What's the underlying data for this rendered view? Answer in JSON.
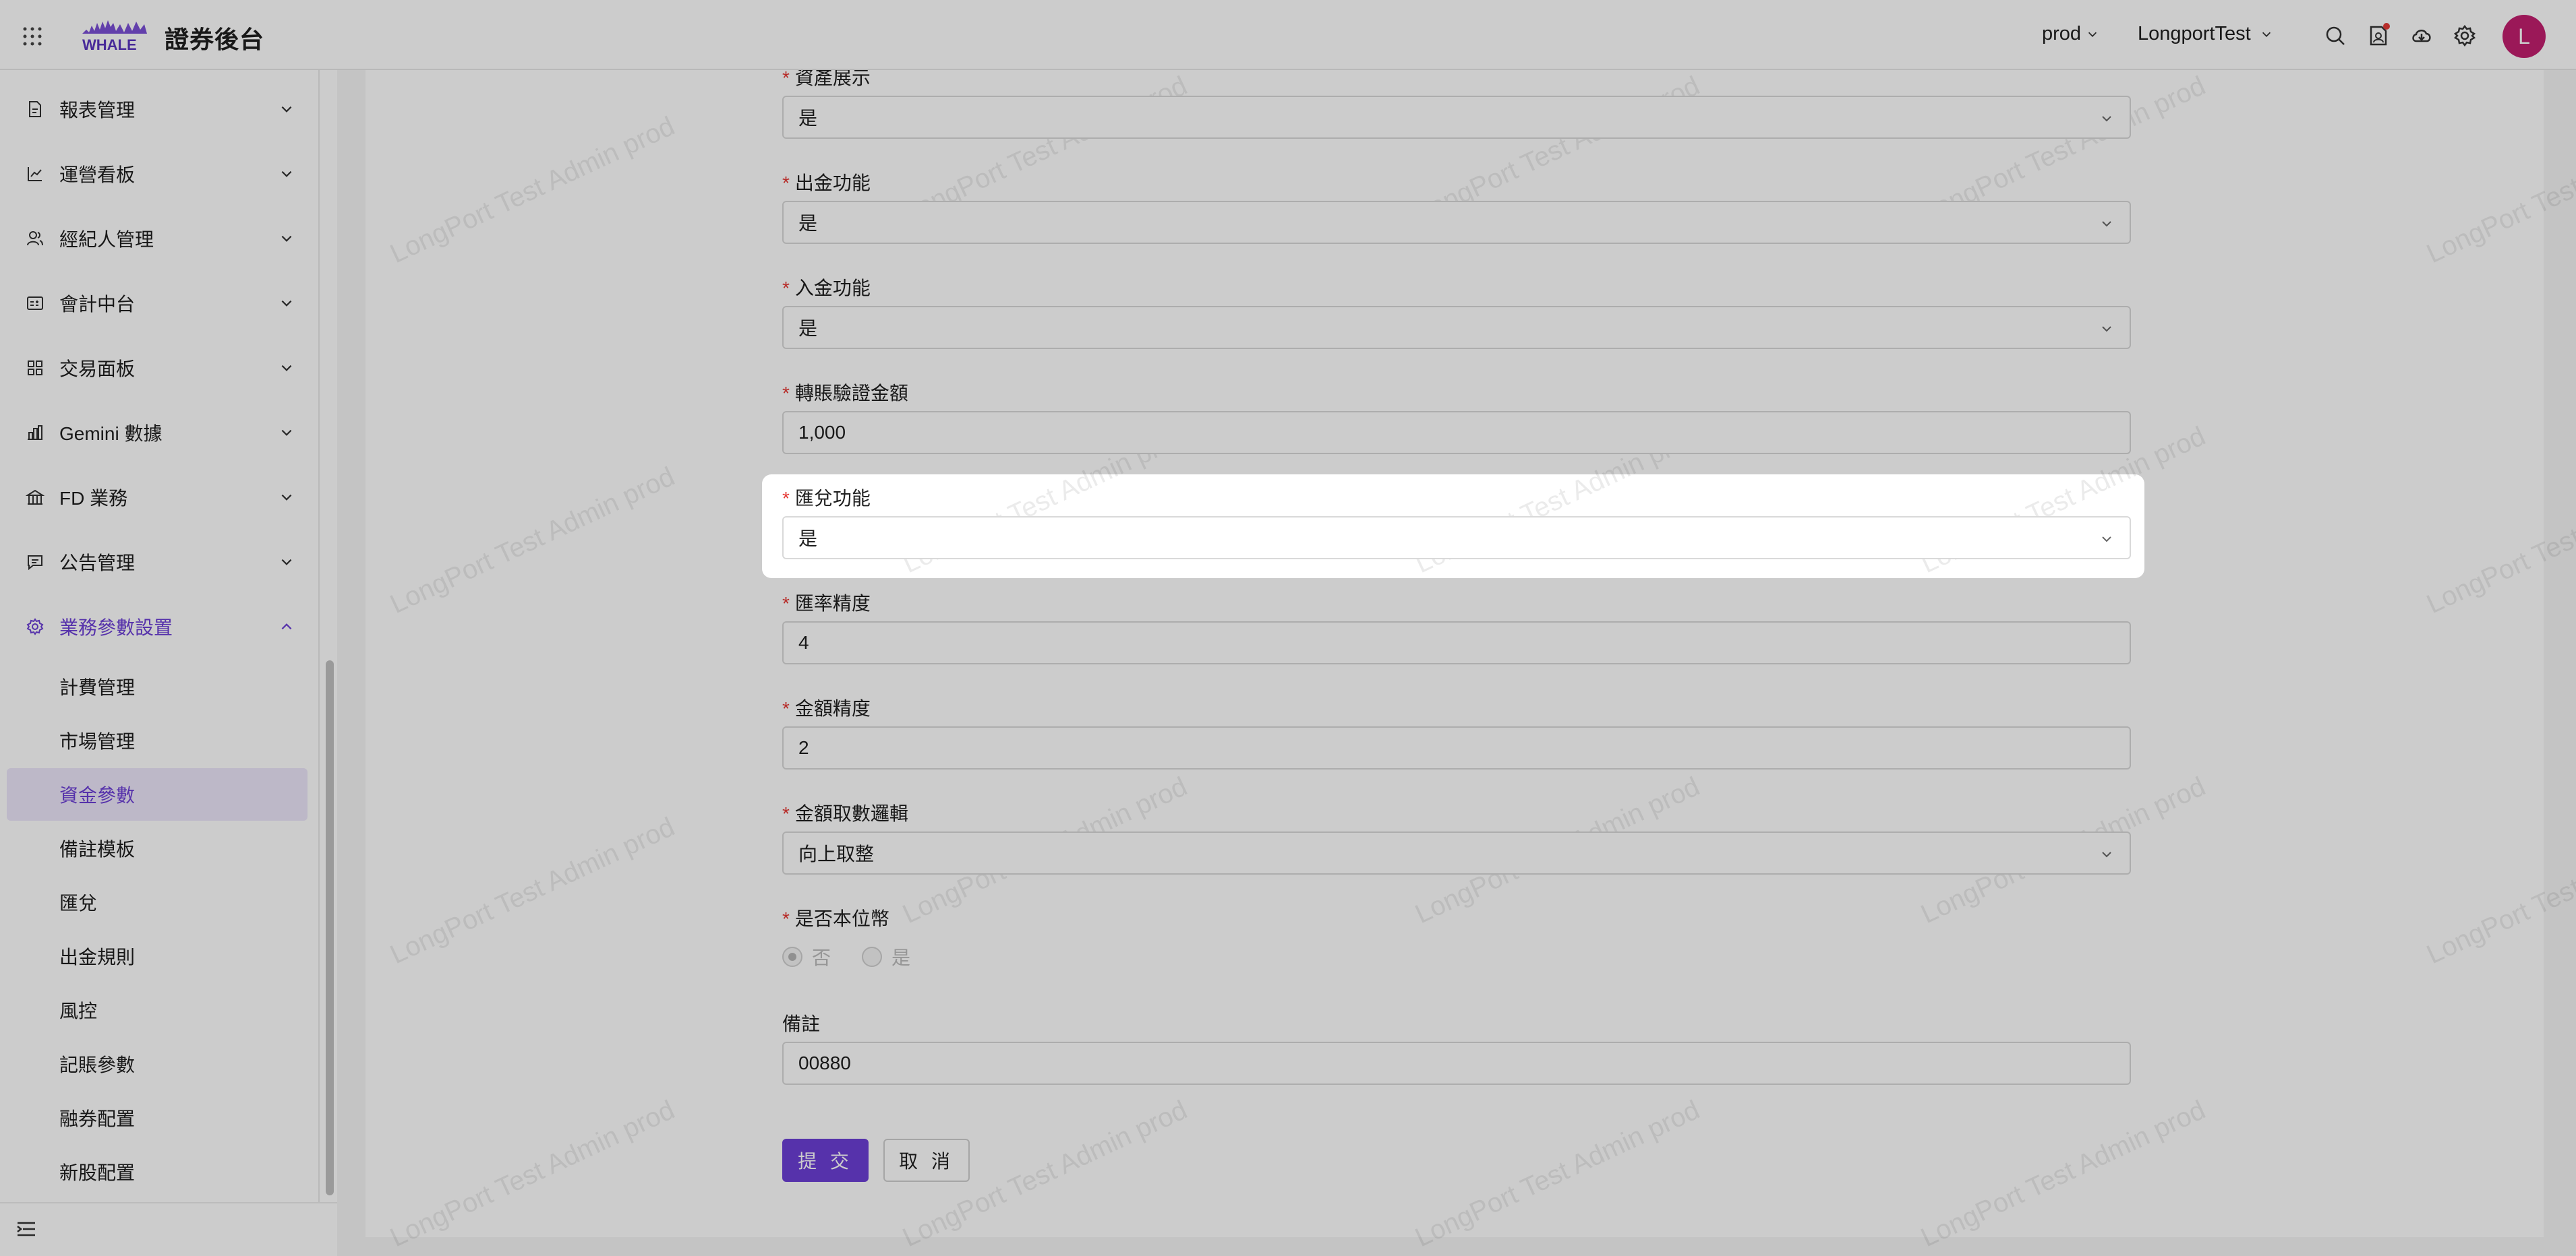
{
  "header": {
    "title": "證券後台",
    "env": "prod",
    "tenant": "LongportTest",
    "avatar_initial": "L"
  },
  "sidebar": {
    "menu": [
      {
        "label": "報表管理",
        "icon": "report-icon"
      },
      {
        "label": "運營看板",
        "icon": "chart-line-icon"
      },
      {
        "label": "經紀人管理",
        "icon": "users-icon"
      },
      {
        "label": "會計中台",
        "icon": "accounting-icon"
      },
      {
        "label": "交易面板",
        "icon": "grid-icon"
      },
      {
        "label": "Gemini 數據",
        "icon": "bar-chart-icon"
      },
      {
        "label": "FD 業務",
        "icon": "bank-icon"
      },
      {
        "label": "公告管理",
        "icon": "message-icon"
      },
      {
        "label": "業務參數設置",
        "icon": "gear-icon"
      }
    ],
    "submenu": [
      {
        "label": "計費管理"
      },
      {
        "label": "市場管理"
      },
      {
        "label": "資金參數"
      },
      {
        "label": "備註模板"
      },
      {
        "label": "匯兌"
      },
      {
        "label": "出金規則"
      },
      {
        "label": "風控"
      },
      {
        "label": "記賬參數"
      },
      {
        "label": "融券配置"
      },
      {
        "label": "新股配置"
      }
    ]
  },
  "form": {
    "fields": [
      {
        "label": "資產展示",
        "value": "是",
        "type": "select"
      },
      {
        "label": "出金功能",
        "value": "是",
        "type": "select"
      },
      {
        "label": "入金功能",
        "value": "是",
        "type": "select"
      },
      {
        "label": "轉賬驗證金額",
        "value": "1,000",
        "type": "input"
      },
      {
        "label": "匯兌功能",
        "value": "是",
        "type": "select"
      },
      {
        "label": "匯率精度",
        "value": "4",
        "type": "input"
      },
      {
        "label": "金額精度",
        "value": "2",
        "type": "input"
      },
      {
        "label": "金額取數邏輯",
        "value": "向上取整",
        "type": "select"
      }
    ],
    "base_currency_label": "是否本位幣",
    "base_currency_options": [
      "否",
      "是"
    ],
    "base_currency_selected": "否",
    "remark_label": "備註",
    "remark_value": "00880",
    "submit_label": "提 交",
    "cancel_label": "取 消"
  },
  "watermark_text": "LongPort Test Admin prod",
  "colors": {
    "accent": "#6c3fd6",
    "required": "#e53935",
    "avatar": "#c21f6f"
  }
}
